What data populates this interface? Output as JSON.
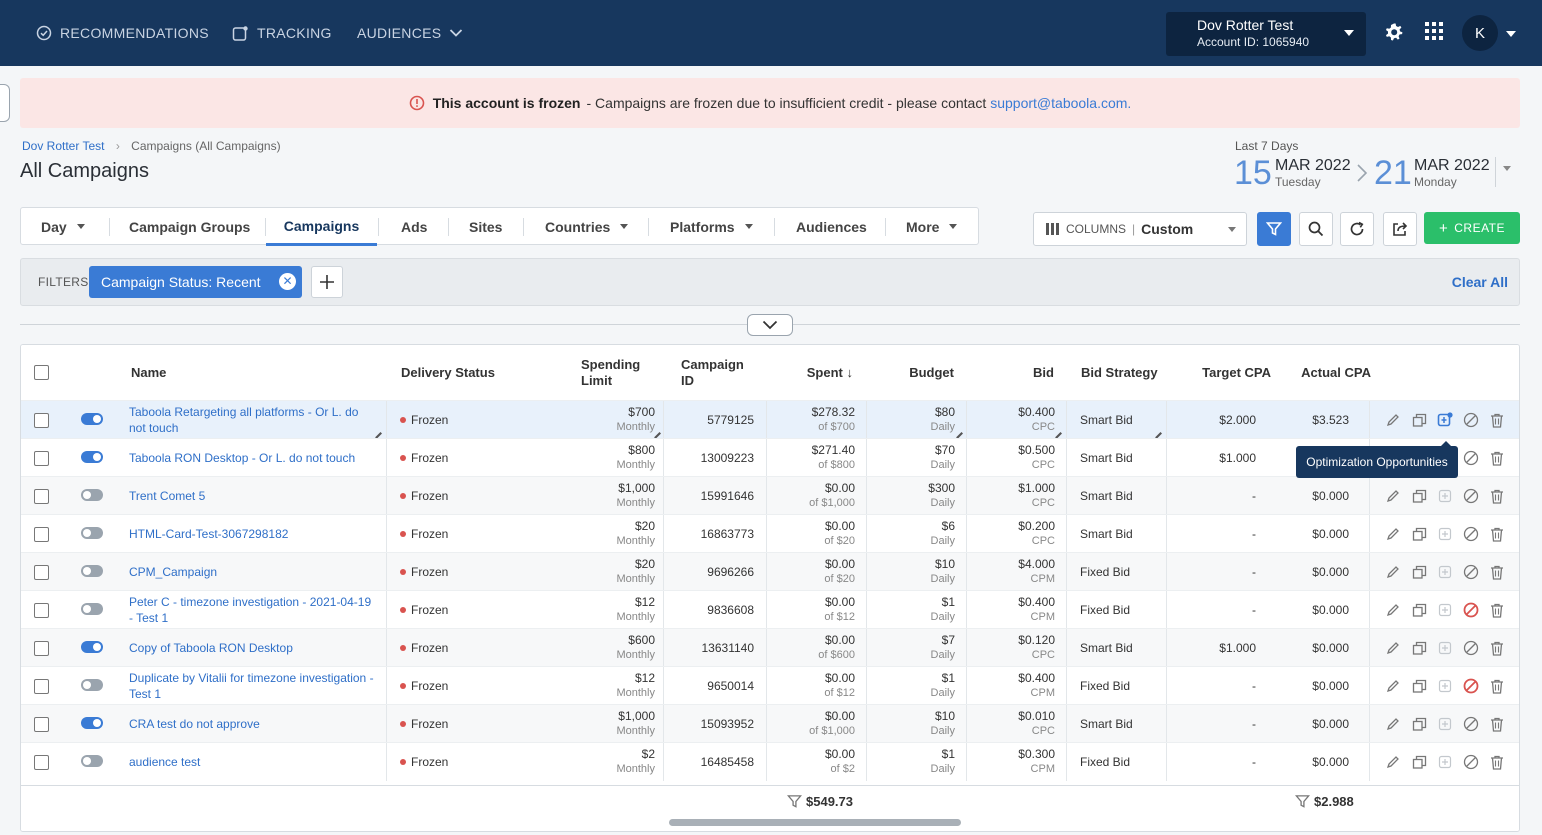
{
  "nav": {
    "recommendations": "RECOMMENDATIONS",
    "tracking": "TRACKING",
    "audiences": "AUDIENCES"
  },
  "account": {
    "name": "Dov Rotter Test",
    "id_label": "Account ID: 1065940",
    "avatar_initial": "K"
  },
  "banner": {
    "bold": "This account is frozen",
    "text": "- Campaigns are frozen due to insufficient credit - please contact",
    "email": "support@taboola.com."
  },
  "breadcrumb": {
    "root": "Dov Rotter Test",
    "current": "Campaigns (All Campaigns)"
  },
  "page_title": "All Campaigns",
  "date_range": {
    "label": "Last 7 Days",
    "start_day": "15",
    "start_month": "MAR 2022",
    "start_weekday": "Tuesday",
    "end_day": "21",
    "end_month": "MAR 2022",
    "end_weekday": "Monday"
  },
  "tabs": [
    "Day",
    "Campaign Groups",
    "Campaigns",
    "Ads",
    "Sites",
    "Countries",
    "Platforms",
    "Audiences",
    "More"
  ],
  "columns_selector": {
    "label": "COLUMNS",
    "value": "Custom"
  },
  "create_label": "CREATE",
  "filters": {
    "label": "FILTERS",
    "chip": "Campaign Status: Recent",
    "clear_all": "Clear All"
  },
  "headers": {
    "name": "Name",
    "delivery_status": "Delivery Status",
    "spending_limit_1": "Spending",
    "spending_limit_2": "Limit",
    "campaign_id_1": "Campaign",
    "campaign_id_2": "ID",
    "spent": "Spent ↓",
    "budget": "Budget",
    "bid": "Bid",
    "bid_strategy": "Bid Strategy",
    "target_cpa": "Target CPA",
    "actual_cpa": "Actual CPA"
  },
  "rows": [
    {
      "enabled": true,
      "name": "Taboola Retargeting all platforms - Or L. do not touch",
      "status": "Frozen",
      "limit": "$700",
      "limit_period": "Monthly",
      "id": "5779125",
      "spent": "$278.32",
      "spent_of": "of $700",
      "budget": "$80",
      "budget_period": "Daily",
      "bid": "$0.400",
      "bid_type": "CPC",
      "strategy": "Smart Bid",
      "target_cpa": "$2.000",
      "actual_cpa": "$3.523",
      "paused_icon": false
    },
    {
      "enabled": true,
      "name": "Taboola RON Desktop - Or L. do not touch",
      "status": "Frozen",
      "limit": "$800",
      "limit_period": "Monthly",
      "id": "13009223",
      "spent": "$271.40",
      "spent_of": "of $800",
      "budget": "$70",
      "budget_period": "Daily",
      "bid": "$0.500",
      "bid_type": "CPC",
      "strategy": "Smart Bid",
      "target_cpa": "$1.000",
      "actual_cpa": "",
      "paused_icon": false
    },
    {
      "enabled": false,
      "name": "Trent Comet 5",
      "status": "Frozen",
      "limit": "$1,000",
      "limit_period": "Monthly",
      "id": "15991646",
      "spent": "$0.00",
      "spent_of": "of $1,000",
      "budget": "$300",
      "budget_period": "Daily",
      "bid": "$1.000",
      "bid_type": "CPC",
      "strategy": "Smart Bid",
      "target_cpa": "-",
      "actual_cpa": "$0.000",
      "paused_icon": false
    },
    {
      "enabled": false,
      "name": "HTML-Card-Test-3067298182",
      "status": "Frozen",
      "limit": "$20",
      "limit_period": "Monthly",
      "id": "16863773",
      "spent": "$0.00",
      "spent_of": "of $20",
      "budget": "$6",
      "budget_period": "Daily",
      "bid": "$0.200",
      "bid_type": "CPC",
      "strategy": "Smart Bid",
      "target_cpa": "-",
      "actual_cpa": "$0.000",
      "paused_icon": false
    },
    {
      "enabled": false,
      "name": "CPM_Campaign",
      "status": "Frozen",
      "limit": "$20",
      "limit_period": "Monthly",
      "id": "9696266",
      "spent": "$0.00",
      "spent_of": "of $20",
      "budget": "$10",
      "budget_period": "Daily",
      "bid": "$4.000",
      "bid_type": "CPM",
      "strategy": "Fixed Bid",
      "target_cpa": "-",
      "actual_cpa": "$0.000",
      "paused_icon": false
    },
    {
      "enabled": false,
      "name": "Peter C - timezone investigation - 2021-04-19 - Test 1",
      "status": "Frozen",
      "limit": "$12",
      "limit_period": "Monthly",
      "id": "9836608",
      "spent": "$0.00",
      "spent_of": "of $12",
      "budget": "$1",
      "budget_period": "Daily",
      "bid": "$0.400",
      "bid_type": "CPM",
      "strategy": "Fixed Bid",
      "target_cpa": "-",
      "actual_cpa": "$0.000",
      "paused_icon": true
    },
    {
      "enabled": true,
      "name": "Copy of Taboola RON Desktop",
      "status": "Frozen",
      "limit": "$600",
      "limit_period": "Monthly",
      "id": "13631140",
      "spent": "$0.00",
      "spent_of": "of $600",
      "budget": "$7",
      "budget_period": "Daily",
      "bid": "$0.120",
      "bid_type": "CPC",
      "strategy": "Smart Bid",
      "target_cpa": "$1.000",
      "actual_cpa": "$0.000",
      "paused_icon": false
    },
    {
      "enabled": false,
      "name": "Duplicate by Vitalii for timezone investigation - Test 1",
      "status": "Frozen",
      "limit": "$12",
      "limit_period": "Monthly",
      "id": "9650014",
      "spent": "$0.00",
      "spent_of": "of $12",
      "budget": "$1",
      "budget_period": "Daily",
      "bid": "$0.400",
      "bid_type": "CPM",
      "strategy": "Fixed Bid",
      "target_cpa": "-",
      "actual_cpa": "$0.000",
      "paused_icon": true
    },
    {
      "enabled": true,
      "name": "CRA test do not approve",
      "status": "Frozen",
      "limit": "$1,000",
      "limit_period": "Monthly",
      "id": "15093952",
      "spent": "$0.00",
      "spent_of": "of $1,000",
      "budget": "$10",
      "budget_period": "Daily",
      "bid": "$0.010",
      "bid_type": "CPC",
      "strategy": "Smart Bid",
      "target_cpa": "-",
      "actual_cpa": "$0.000",
      "paused_icon": false
    },
    {
      "enabled": false,
      "name": "audience test",
      "status": "Frozen",
      "limit": "$2",
      "limit_period": "Monthly",
      "id": "16485458",
      "spent": "$0.00",
      "spent_of": "of $2",
      "budget": "$1",
      "budget_period": "Daily",
      "bid": "$0.300",
      "bid_type": "CPM",
      "strategy": "Fixed Bid",
      "target_cpa": "-",
      "actual_cpa": "$0.000",
      "paused_icon": false
    }
  ],
  "tooltip": "Optimization Opportunities",
  "totals": {
    "spent": "$549.73",
    "actual_cpa": "$2.988"
  },
  "colors": {
    "topbar": "#17375e",
    "accent": "#3a7bd5",
    "create": "#2bbf6a",
    "frozen": "#d9534f",
    "banner": "#fbe6e5"
  }
}
